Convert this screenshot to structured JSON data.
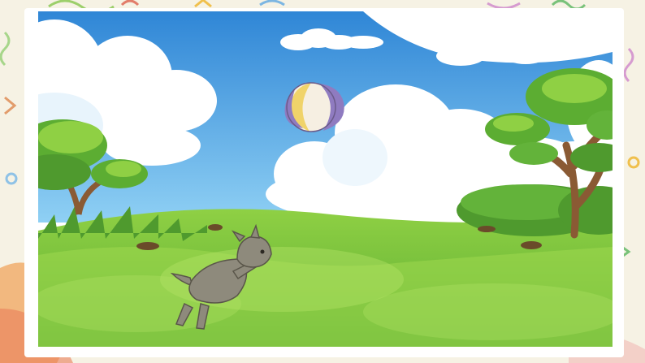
{
  "scene": {
    "sky_top": "#2f86d6",
    "sky_bottom": "#7cc3f0",
    "grass_light": "#9bd84b",
    "grass_dark": "#63b33a",
    "tree_leaf": "#5cad32",
    "tree_trunk": "#8a5a34",
    "dog_color": "#8e8a7c",
    "ball_colors": [
      "#8f7bc0",
      "#f0d36a",
      "#f6efe2"
    ]
  }
}
